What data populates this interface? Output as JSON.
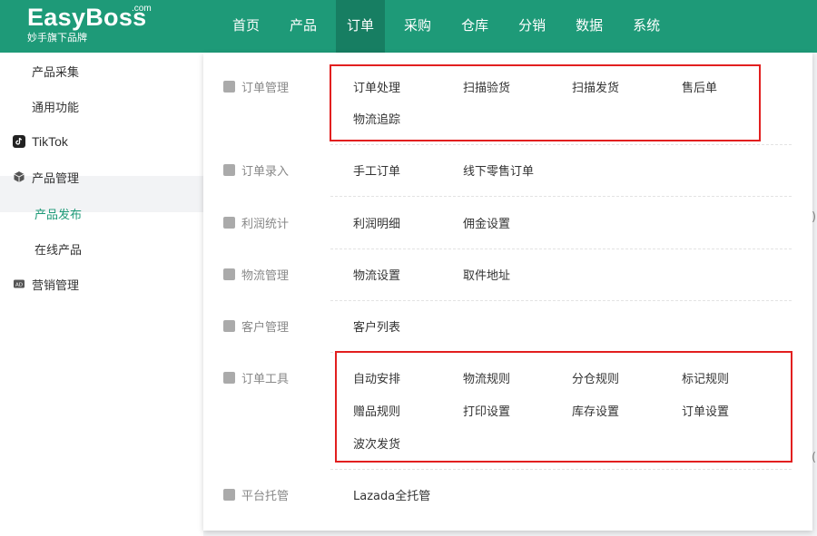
{
  "logo": {
    "main": "EasyBoss",
    "com": ".com",
    "sub": "妙手旗下品牌"
  },
  "nav": [
    "首页",
    "产品",
    "订单",
    "采购",
    "仓库",
    "分销",
    "数据",
    "系统"
  ],
  "sidebar": {
    "items": [
      {
        "label": "产品采集",
        "icon": "grid-icon"
      },
      {
        "label": "通用功能",
        "icon": "grid-icon"
      },
      {
        "label": "TikTok",
        "icon": "tiktok-icon"
      },
      {
        "label": "产品管理",
        "icon": "cube-icon"
      },
      {
        "label": "营销管理",
        "icon": "ad-icon"
      }
    ],
    "subitems": [
      "产品发布",
      "在线产品"
    ]
  },
  "menu": {
    "categories": [
      {
        "label": "订单管理",
        "icon": "order-icon",
        "links": [
          "订单处理",
          "扫描验货",
          "扫描发货",
          "售后单",
          "物流追踪"
        ]
      },
      {
        "label": "订单录入",
        "icon": "entry-icon",
        "links": [
          "手工订单",
          "线下零售订单"
        ]
      },
      {
        "label": "利润统计",
        "icon": "profit-icon",
        "links": [
          "利润明细",
          "佣金设置"
        ]
      },
      {
        "label": "物流管理",
        "icon": "truck-icon",
        "links": [
          "物流设置",
          "取件地址"
        ]
      },
      {
        "label": "客户管理",
        "icon": "customer-icon",
        "links": [
          "客户列表"
        ]
      },
      {
        "label": "订单工具",
        "icon": "tool-icon",
        "links": [
          "自动安排",
          "物流规则",
          "分仓规则",
          "标记规则",
          "赠品规则",
          "打印设置",
          "库存设置",
          "订单设置",
          "波次发货"
        ]
      },
      {
        "label": "平台托管",
        "icon": "platform-icon",
        "links": [
          "Lazada全托管"
        ]
      }
    ]
  },
  "colors": {
    "brand": "#1e9a78",
    "nav_active": "#177e62",
    "highlight": "#e21f1f"
  }
}
